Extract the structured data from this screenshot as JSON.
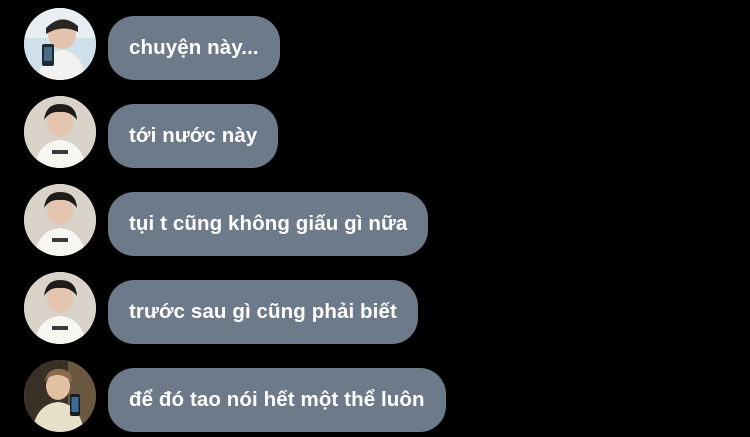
{
  "chat": {
    "bubble_color": "#6c7a8a",
    "background_color": "#000000",
    "text_color": "#ffffff",
    "messages": [
      {
        "text": "chuyện này...",
        "avatar": "avatar-photo-a"
      },
      {
        "text": "tới nước này",
        "avatar": "avatar-photo-b"
      },
      {
        "text": "tụi t cũng không giấu gì nữa",
        "avatar": "avatar-photo-b"
      },
      {
        "text": "trước sau gì cũng phải biết",
        "avatar": "avatar-photo-b"
      },
      {
        "text": "để đó tao nói hết một thể luôn",
        "avatar": "avatar-photo-c"
      }
    ]
  }
}
